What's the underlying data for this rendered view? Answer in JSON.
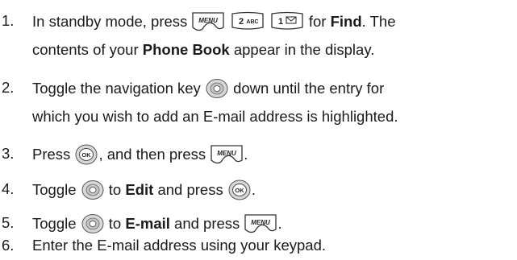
{
  "header_fragment": "",
  "steps": [
    {
      "num": "1.",
      "a": "In standby mode, press",
      "b": "for",
      "bold1": "Find",
      "c": ". The",
      "line2_a": "contents of your",
      "bold2": "Phone Book",
      "line2_b": "appear in the display.",
      "keys": [
        "MENU",
        "2ABC",
        "1"
      ]
    },
    {
      "num": "2.",
      "a": "Toggle the navigation key",
      "b": "down until the entry for",
      "line2": "which you wish to add an E-mail address is highlighted."
    },
    {
      "num": "3.",
      "a": "Press",
      "b": ", and then press",
      "c": "."
    },
    {
      "num": "4.",
      "a": "Toggle",
      "b": "to",
      "bold1": "Edit",
      "c": "and press",
      "d": "."
    },
    {
      "num": "5.",
      "a": "Toggle",
      "b": "to",
      "bold1": "E-mail",
      "c": "and press",
      "d": "."
    },
    {
      "num": "6.",
      "a": "Enter the E-mail address using your keypad."
    }
  ],
  "icons": {
    "menu_key": "menu-key-icon",
    "two_key": "2-abc-key-icon",
    "one_key": "1-voicemail-key-icon",
    "nav_key": "navigation-key-icon",
    "ok_key": "ok-key-icon"
  },
  "key_labels": {
    "menu": "MENU",
    "two": "2",
    "abc": "ABC",
    "one": "1",
    "ok": "OK"
  }
}
